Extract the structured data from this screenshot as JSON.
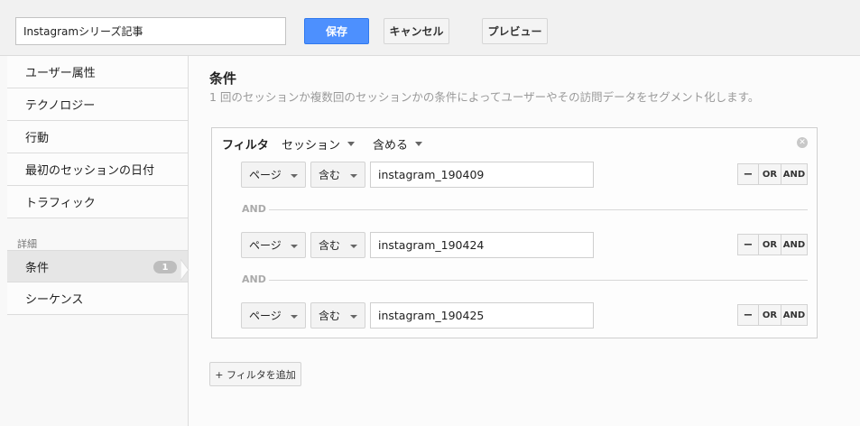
{
  "toolbar": {
    "segment_name": "Instagramシリーズ記事",
    "save_label": "保存",
    "cancel_label": "キャンセル",
    "preview_label": "プレビュー"
  },
  "sidebar": {
    "items": [
      {
        "label": "ユーザー属性"
      },
      {
        "label": "テクノロジー"
      },
      {
        "label": "行動"
      },
      {
        "label": "最初のセッションの日付"
      },
      {
        "label": "トラフィック"
      }
    ],
    "group_label": "詳細",
    "advanced": [
      {
        "label": "条件",
        "badge": "1",
        "active": true
      },
      {
        "label": "シーケンス"
      }
    ]
  },
  "main": {
    "title": "条件",
    "description": "1 回のセッションか複数回のセッションかの条件によってユーザーやその訪問データをセグメント化します。",
    "filter": {
      "label": "フィルタ",
      "scope": "セッション",
      "mode": "含める",
      "conditions": [
        {
          "dimension": "ページ",
          "operator": "含む",
          "value": "instagram_190409"
        },
        {
          "dimension": "ページ",
          "operator": "含む",
          "value": "instagram_190424"
        },
        {
          "dimension": "ページ",
          "operator": "含む",
          "value": "instagram_190425"
        }
      ],
      "separator_label": "AND",
      "minus_label": "−",
      "or_label": "OR",
      "and_label": "AND"
    },
    "add_filter_label": "+ フィルタを追加"
  },
  "colors": {
    "primary_button": "#4d90fe",
    "badge": "#bdbdbd"
  }
}
